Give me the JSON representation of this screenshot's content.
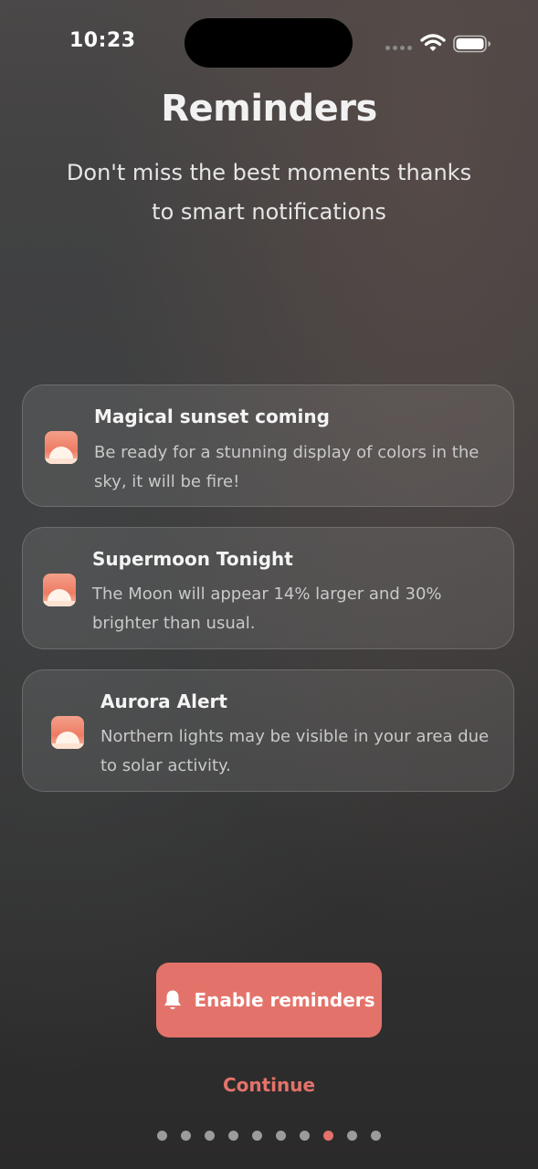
{
  "status_bar": {
    "time": "10:23",
    "icons": [
      "signal-icon",
      "wifi-icon",
      "battery-icon"
    ]
  },
  "header": {
    "title": "Reminders",
    "subtitle": "Don't miss the best moments thanks to smart notifications"
  },
  "notifications": [
    {
      "icon": "sunrise-icon",
      "title": "Magical sunset coming",
      "body": "Be ready for a stunning display of colors in the sky, it will be fire!"
    },
    {
      "icon": "sunrise-icon",
      "title": "Supermoon Tonight",
      "body": "The Moon will appear 14% larger and 30% brighter than usual."
    },
    {
      "icon": "sunrise-icon",
      "title": "Aurora Alert",
      "body": "Northern lights may be visible in your area due to solar activity."
    }
  ],
  "actions": {
    "enable_label": "Enable reminders",
    "enable_icon": "bell-icon",
    "continue_label": "Continue"
  },
  "pagination": {
    "total": 10,
    "current": 8
  },
  "colors": {
    "accent": "#e3736a",
    "dot_inactive": "#9b9b9b",
    "card_background": "rgba(255,255,255,0.09)"
  }
}
